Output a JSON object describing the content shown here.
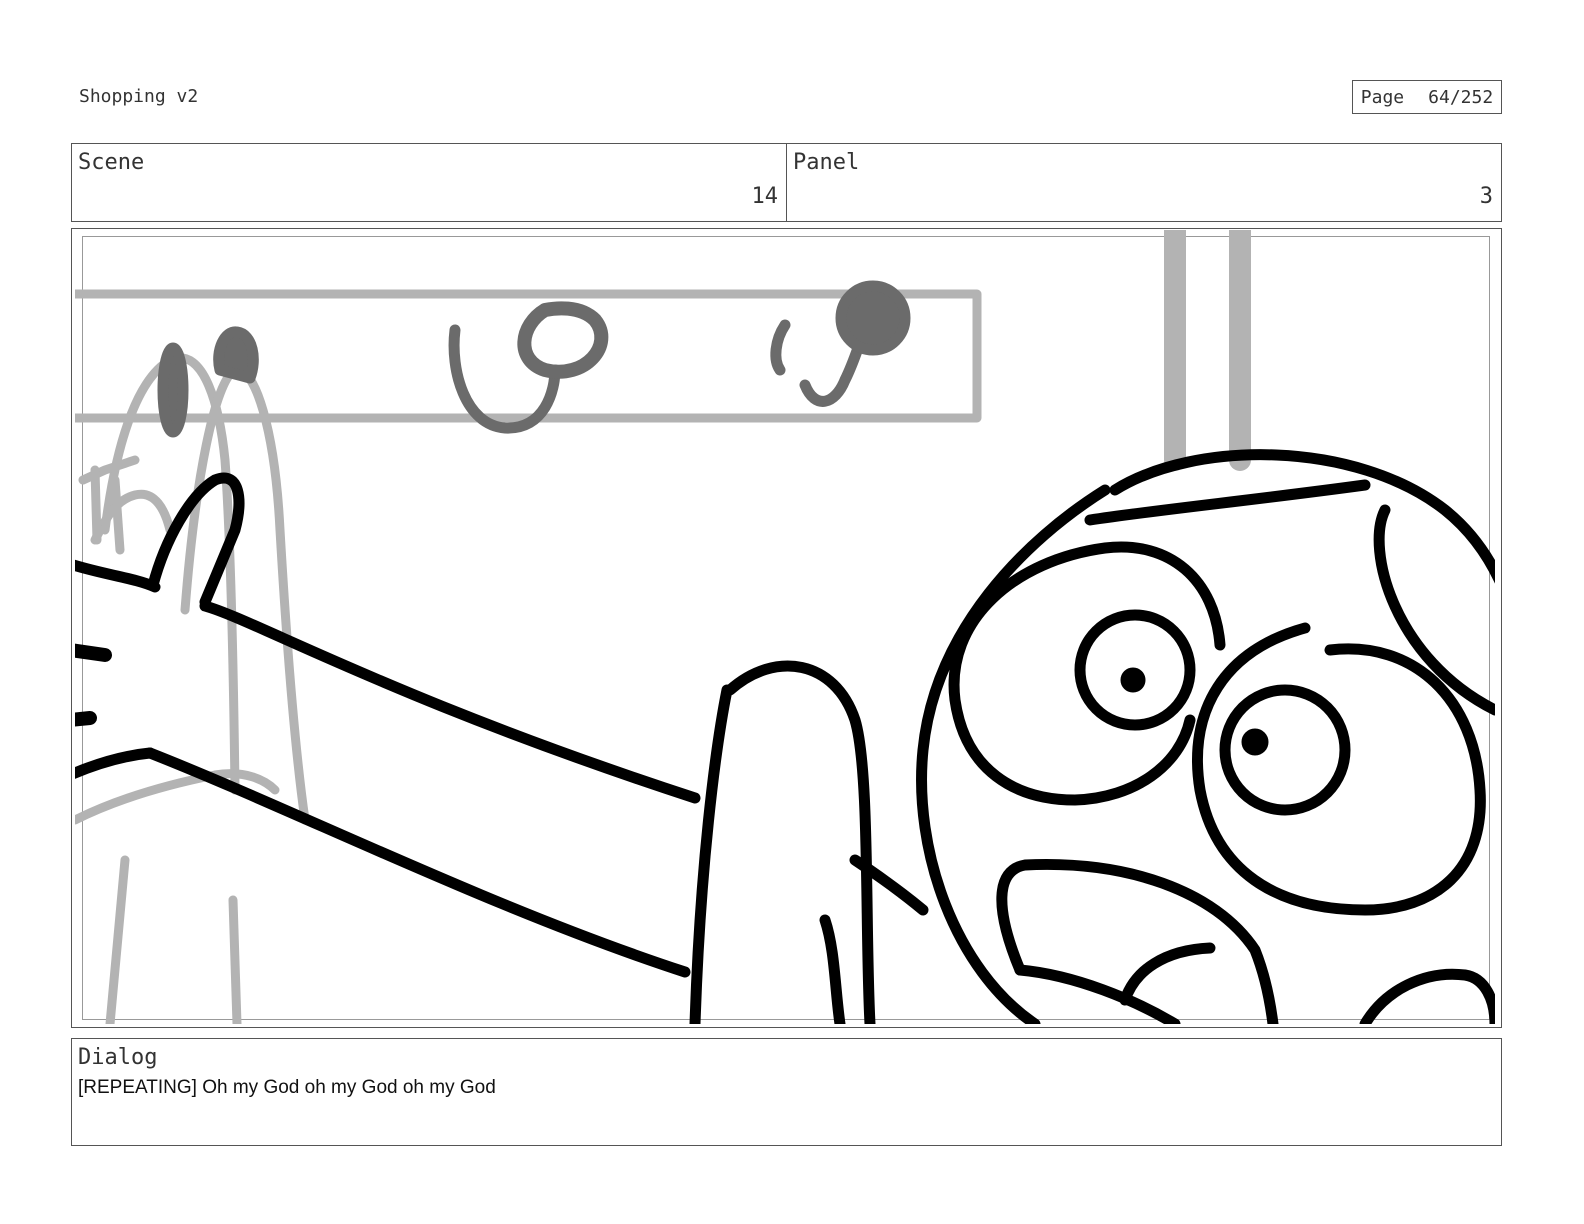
{
  "header": {
    "title": "Shopping v2",
    "page_label": "Page",
    "page_number": "64/252"
  },
  "scene": {
    "label": "Scene",
    "value": "14"
  },
  "panel": {
    "label": "Panel",
    "value": "3"
  },
  "dialog": {
    "label": "Dialog",
    "text": "[REPEATING] Oh my God oh my God oh my God"
  },
  "colors": {
    "ink": "#000000",
    "light_sketch": "#b3b3b3",
    "mid_sketch": "#6b6b6b",
    "border": "#555555"
  }
}
